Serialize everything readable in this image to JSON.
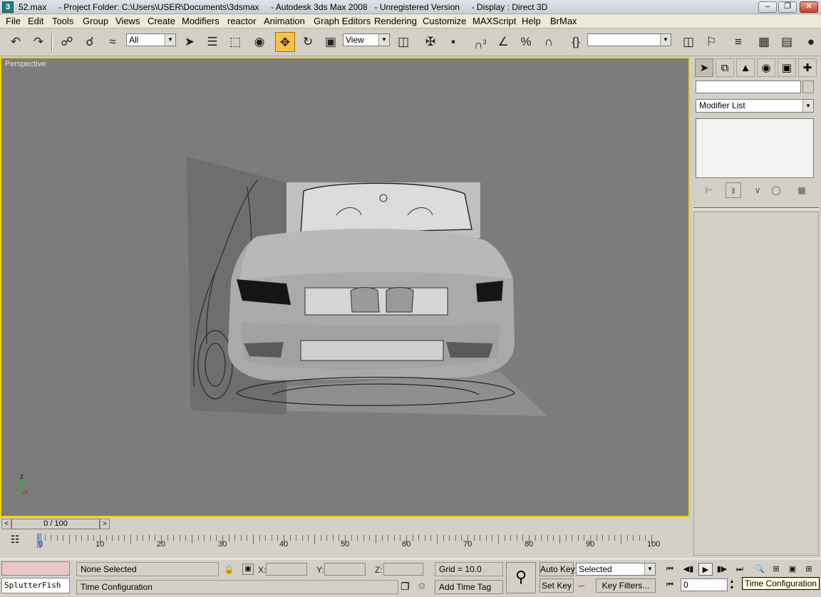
{
  "window": {
    "title": "52.max     - Project Folder: C:\\Users\\USER\\Documents\\3dsmax     - Autodesk 3ds Max 2008   - Unregistered Version     - Display : Direct 3D",
    "icon": "3"
  },
  "menu": [
    "File",
    "Edit",
    "Tools",
    "Group",
    "Views",
    "Create",
    "Modifiers",
    "reactor",
    "Animation",
    "Graph Editors",
    "Rendering",
    "Customize",
    "MAXScript",
    "Help",
    "BrMax"
  ],
  "toolbar": {
    "selection_filter": "All",
    "reference_coord": "View",
    "snap_3_label": "3",
    "named_selection": ""
  },
  "viewport": {
    "label": "Perspective",
    "axis_labels": {
      "x": "x",
      "y": "y",
      "z": "z"
    }
  },
  "command_panel": {
    "object_name": "",
    "modifier_list": "Modifier List"
  },
  "time_slider": {
    "position_text": "0 / 100",
    "prev": "<",
    "next": ">"
  },
  "track_bar": {
    "labels": [
      "0",
      "10",
      "20",
      "30",
      "40",
      "50",
      "60",
      "70",
      "80",
      "90",
      "100"
    ]
  },
  "status": {
    "listener_text": "SplutterFish",
    "selection_status": "None Selected",
    "prompt_text": "Time Configuration",
    "x_label": "X:",
    "y_label": "Y:",
    "z_label": "Z:",
    "grid": "Grid = 10.0",
    "add_time_tag": "Add Time Tag",
    "auto_key": "Auto Key",
    "set_key": "Set Key",
    "key_mode": "Selected",
    "key_filters": "Key Filters...",
    "current_frame": "0",
    "tooltip": "Time Configuration"
  },
  "colors": {
    "viewport_bg": "#7c7c7c",
    "active_border": "#f0d000",
    "ui_face": "#d4d0c8"
  }
}
